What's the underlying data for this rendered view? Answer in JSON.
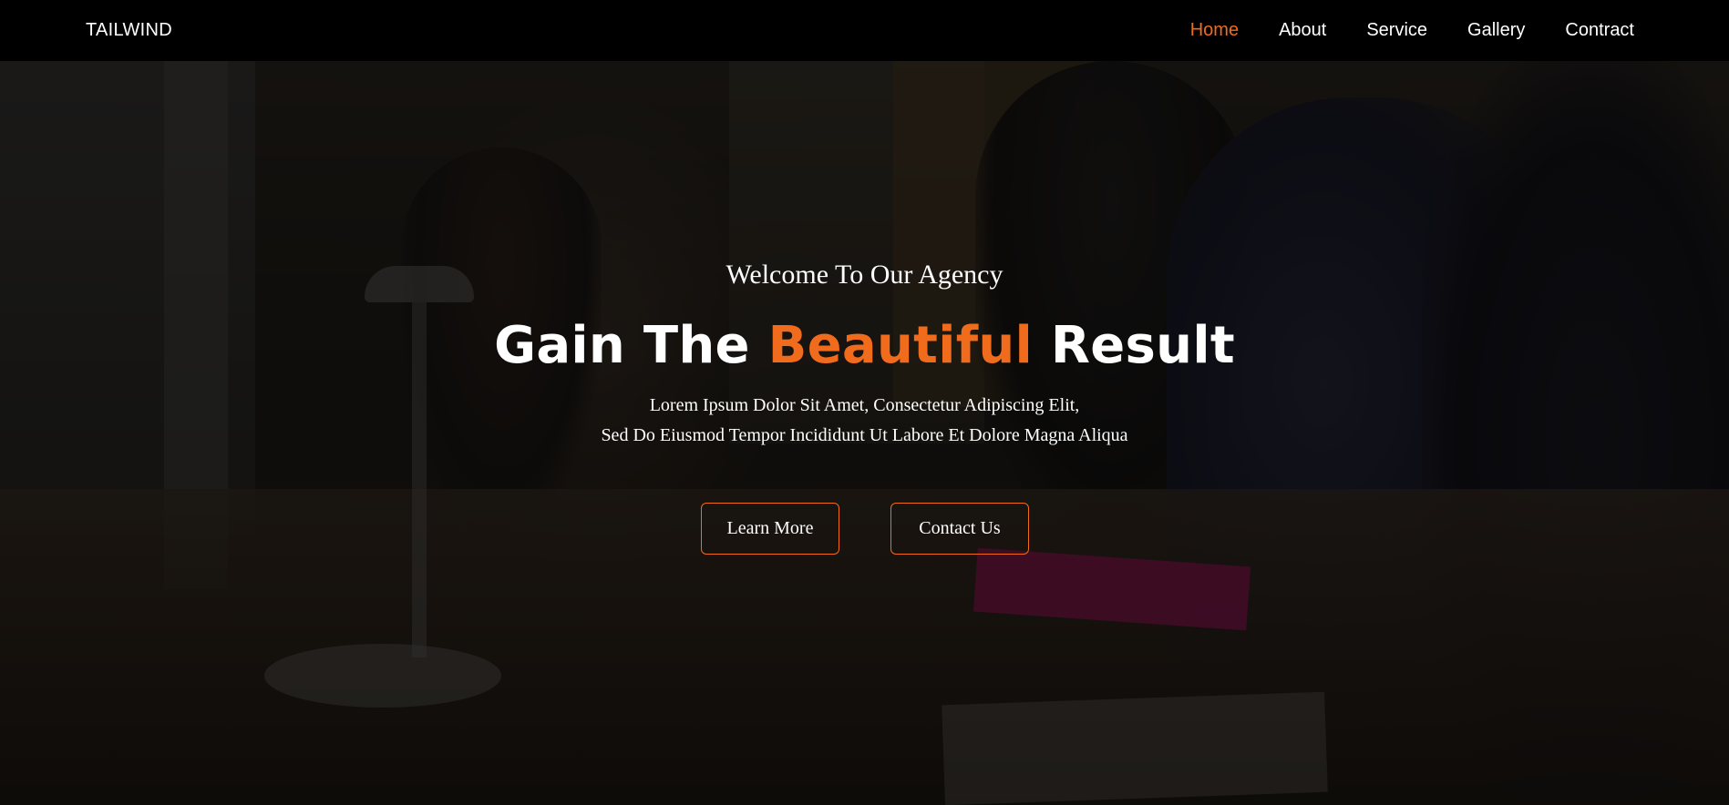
{
  "colors": {
    "accent": "#f06b1c",
    "nav_bg": "#000000",
    "text": "#ffffff"
  },
  "navbar": {
    "brand": "TAILWIND",
    "items": [
      {
        "label": "Home",
        "active": true
      },
      {
        "label": "About",
        "active": false
      },
      {
        "label": "Service",
        "active": false
      },
      {
        "label": "Gallery",
        "active": false
      },
      {
        "label": "Contract",
        "active": false
      }
    ]
  },
  "hero": {
    "welcome": "Welcome To Our Agency",
    "headline": {
      "before": "Gain The ",
      "accent": "Beautiful",
      "after": " Result"
    },
    "description_line1": "Lorem Ipsum Dolor Sit Amet, Consectetur Adipiscing Elit,",
    "description_line2": "Sed Do Eiusmod Tempor Incididunt Ut Labore Et Dolore Magna Aliqua",
    "buttons": {
      "learn_more": "Learn More",
      "contact_us": "Contact Us"
    }
  }
}
